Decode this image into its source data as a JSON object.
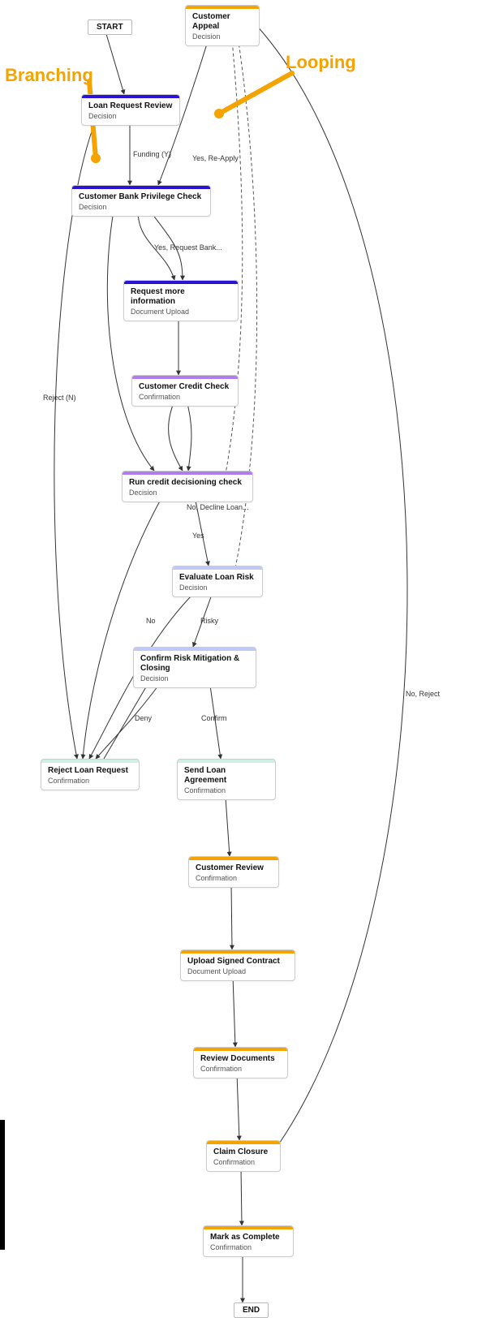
{
  "terminals": {
    "start": "START",
    "end": "END"
  },
  "nodes": {
    "appeal": {
      "title": "Customer Appeal",
      "sub": "Decision"
    },
    "review": {
      "title": "Loan Request Review",
      "sub": "Decision"
    },
    "priv": {
      "title": "Customer Bank Privilege Check",
      "sub": "Decision"
    },
    "reqinfo": {
      "title": "Request more information",
      "sub": "Document Upload"
    },
    "credit": {
      "title": "Customer Credit Check",
      "sub": "Confirmation"
    },
    "runcheck": {
      "title": "Run credit decisioning check",
      "sub": "Decision"
    },
    "evalrisk": {
      "title": "Evaluate Loan Risk",
      "sub": "Decision"
    },
    "confirm": {
      "title": "Confirm Risk Mitigation & Closing",
      "sub": "Decision"
    },
    "reject": {
      "title": "Reject Loan Request",
      "sub": "Confirmation"
    },
    "sendag": {
      "title": "Send Loan Agreement",
      "sub": "Confirmation"
    },
    "custrev": {
      "title": "Customer Review",
      "sub": "Confirmation"
    },
    "upload": {
      "title": "Upload Signed Contract",
      "sub": "Document Upload"
    },
    "revdocs": {
      "title": "Review Documents",
      "sub": "Confirmation"
    },
    "closure": {
      "title": "Claim Closure",
      "sub": "Confirmation"
    },
    "complete": {
      "title": "Mark as Complete",
      "sub": "Confirmation"
    }
  },
  "labels": {
    "funding": "Funding (Y)",
    "rejectn": "Reject (N)",
    "reqbank": "Yes, Request Bank...",
    "reapply": "Yes, Re-Apply",
    "decline": "No, Decline Loan...",
    "yes": "Yes",
    "no": "No",
    "risky": "Risky",
    "deny": "Deny",
    "confirm": "Confirm",
    "noreject": "No, Reject"
  },
  "annotations": {
    "branching": "Branching",
    "looping": "Looping"
  },
  "colors": {
    "orange": "#f5a300",
    "blue": "#2a12d6",
    "purple": "#b07cf0",
    "lightblue": "#c0c9f6",
    "mint": "#cfeee5"
  },
  "edges": [
    {
      "from": "START",
      "to": "Loan Request Review"
    },
    {
      "from": "Loan Request Review",
      "to": "Customer Bank Privilege Check",
      "label": "Funding (Y)"
    },
    {
      "from": "Loan Request Review",
      "to": "Reject Loan Request",
      "label": "Reject (N)"
    },
    {
      "from": "Customer Bank Privilege Check",
      "to": "Request more information",
      "label": "Yes, Request Bank..."
    },
    {
      "from": "Customer Bank Privilege Check",
      "to": "Run credit decisioning check"
    },
    {
      "from": "Request more information",
      "to": "Customer Credit Check"
    },
    {
      "from": "Customer Credit Check",
      "to": "Run credit decisioning check"
    },
    {
      "from": "Run credit decisioning check",
      "to": "Evaluate Loan Risk",
      "label": "Yes"
    },
    {
      "from": "Run credit decisioning check",
      "to": "Reject Loan Request",
      "label": "No, Decline Loan..."
    },
    {
      "from": "Run credit decisioning check",
      "to": "Customer Appeal",
      "style": "dashed"
    },
    {
      "from": "Evaluate Loan Risk",
      "to": "Confirm Risk Mitigation & Closing",
      "label": "Risky"
    },
    {
      "from": "Evaluate Loan Risk",
      "to": "Reject Loan Request",
      "label": "No"
    },
    {
      "from": "Evaluate Loan Risk",
      "to": "Customer Appeal",
      "style": "dashed"
    },
    {
      "from": "Confirm Risk Mitigation & Closing",
      "to": "Reject Loan Request",
      "label": "Deny"
    },
    {
      "from": "Confirm Risk Mitigation & Closing",
      "to": "Send Loan Agreement",
      "label": "Confirm"
    },
    {
      "from": "Send Loan Agreement",
      "to": "Customer Review"
    },
    {
      "from": "Customer Review",
      "to": "Upload Signed Contract"
    },
    {
      "from": "Upload Signed Contract",
      "to": "Review Documents"
    },
    {
      "from": "Review Documents",
      "to": "Claim Closure"
    },
    {
      "from": "Claim Closure",
      "to": "Mark as Complete"
    },
    {
      "from": "Mark as Complete",
      "to": "END"
    },
    {
      "from": "Customer Appeal",
      "to": "Customer Bank Privilege Check",
      "label": "Yes, Re-Apply"
    },
    {
      "from": "Customer Appeal",
      "to": "Claim Closure",
      "label": "No, Reject"
    }
  ]
}
